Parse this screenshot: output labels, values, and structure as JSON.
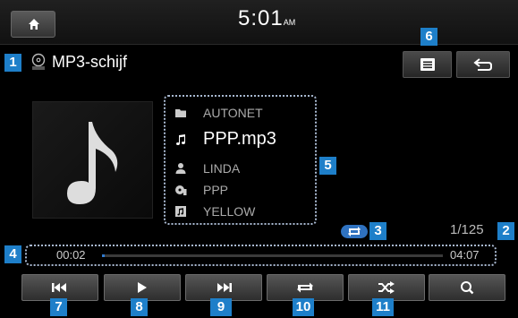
{
  "status_bar": {
    "time": "5:01",
    "meridiem": "AM"
  },
  "header": {
    "source_title": "MP3-schijf",
    "source_icon": "mp3-disc-icon"
  },
  "track": {
    "folder": "AUTONET",
    "file": "PPP.mp3",
    "artist": "LINDA",
    "album": "PPP",
    "genre": "YELLOW",
    "counter": "1/125"
  },
  "progress": {
    "elapsed": "00:02",
    "total": "04:07",
    "fraction": 0.008
  },
  "callouts": [
    "1",
    "2",
    "3",
    "4",
    "5",
    "6",
    "7",
    "8",
    "9",
    "10",
    "11"
  ],
  "controls": [
    "previous-icon",
    "play-icon",
    "next-icon",
    "repeat-icon",
    "shuffle-icon",
    "search-icon"
  ],
  "colors": {
    "callout": "#1e7fc9",
    "accent": "#2f7ad0",
    "background": "#000000"
  }
}
